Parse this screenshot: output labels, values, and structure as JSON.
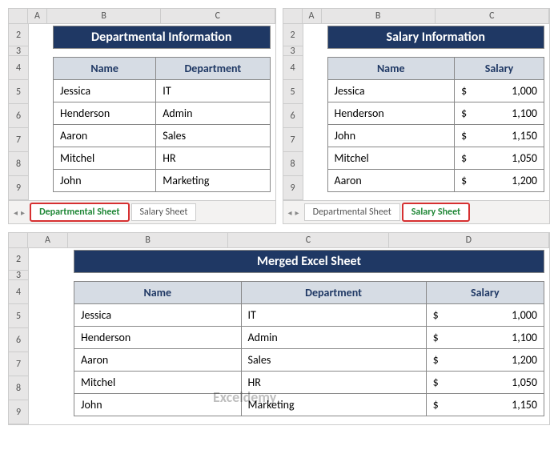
{
  "top_left": {
    "cols": [
      "A",
      "B",
      "C"
    ],
    "rows": [
      "2",
      "3",
      "4",
      "5",
      "6",
      "7",
      "8",
      "9"
    ],
    "title": "Departmental Information",
    "headers": [
      "Name",
      "Department"
    ],
    "data": [
      [
        "Jessica",
        "IT"
      ],
      [
        "Henderson",
        "Admin"
      ],
      [
        "Aaron",
        "Sales"
      ],
      [
        "Mitchel",
        "HR"
      ],
      [
        "John",
        "Marketing"
      ]
    ],
    "tabs": {
      "active": "Departmental Sheet",
      "other": "Salary Sheet"
    }
  },
  "top_right": {
    "cols": [
      "A",
      "B",
      "C"
    ],
    "rows": [
      "2",
      "3",
      "4",
      "5",
      "6",
      "7",
      "8",
      "9"
    ],
    "title": "Salary Information",
    "headers": [
      "Name",
      "Salary"
    ],
    "data": [
      {
        "name": "Jessica",
        "cur": "$",
        "val": "1,000"
      },
      {
        "name": "Henderson",
        "cur": "$",
        "val": "1,100"
      },
      {
        "name": "John",
        "cur": "$",
        "val": "1,150"
      },
      {
        "name": "Mitchel",
        "cur": "$",
        "val": "1,050"
      },
      {
        "name": "Aaron",
        "cur": "$",
        "val": "1,200"
      }
    ],
    "tabs": {
      "other": "Departmental Sheet",
      "active": "Salary Sheet"
    }
  },
  "bottom": {
    "cols": [
      "A",
      "B",
      "C",
      "D"
    ],
    "rows": [
      "2",
      "3",
      "4",
      "5",
      "6",
      "7",
      "8",
      "9"
    ],
    "title": "Merged Excel Sheet",
    "headers": [
      "Name",
      "Department",
      "Salary"
    ],
    "data": [
      {
        "name": "Jessica",
        "dept": "IT",
        "cur": "$",
        "val": "1,000"
      },
      {
        "name": "Henderson",
        "dept": "Admin",
        "cur": "$",
        "val": "1,100"
      },
      {
        "name": "Aaron",
        "dept": "Sales",
        "cur": "$",
        "val": "1,200"
      },
      {
        "name": "Mitchel",
        "dept": "HR",
        "cur": "$",
        "val": "1,050"
      },
      {
        "name": "John",
        "dept": "Marketing",
        "cur": "$",
        "val": "1,150"
      }
    ]
  },
  "nav": {
    "left": "◂",
    "right": "▸"
  },
  "watermark": {
    "brand": "Exceldemy"
  }
}
